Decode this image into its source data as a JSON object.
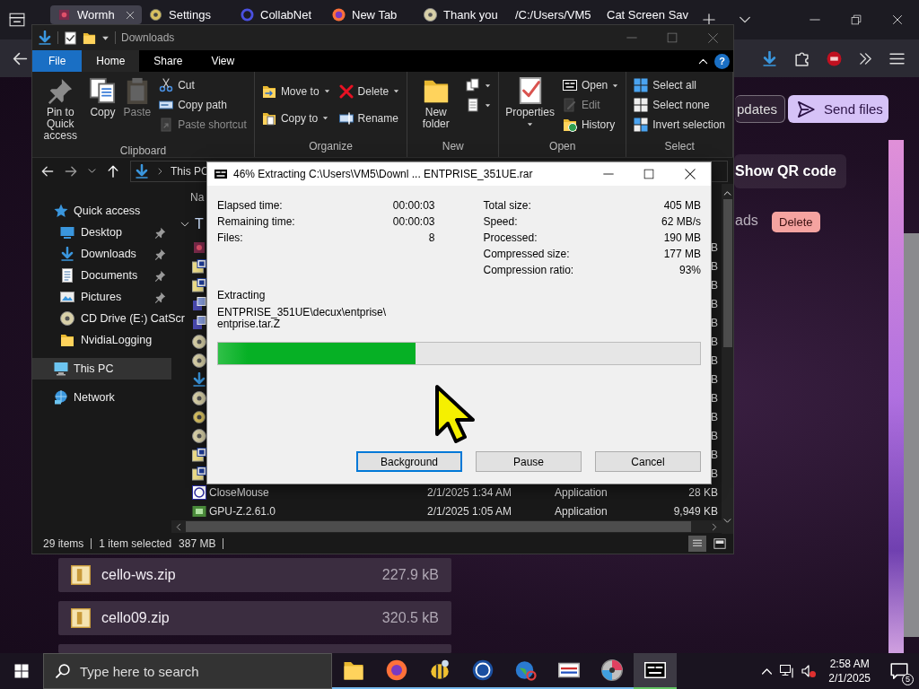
{
  "browser": {
    "tabs": [
      {
        "label": "Wormh",
        "selected": true,
        "kind": "app"
      },
      {
        "label": "Settings",
        "selected": false,
        "kind": "gear"
      },
      {
        "label": "CollabNet",
        "selected": false,
        "kind": "ring"
      },
      {
        "label": "New Tab",
        "selected": false,
        "kind": "browser"
      },
      {
        "label": "Thank you",
        "selected": false,
        "kind": "disc"
      },
      {
        "label": "/C:/Users/VM5",
        "selected": false,
        "kind": "plain"
      },
      {
        "label": "Cat Screen Sav",
        "selected": false,
        "kind": "plain"
      }
    ],
    "page": {
      "header_buttons": [
        {
          "label": "pdates",
          "kind": "outline"
        },
        {
          "label": "Send files",
          "kind": "primary"
        }
      ],
      "qr_button": "Show QR code",
      "section_label": "ads",
      "delete_button": "Delete",
      "files": [
        {
          "name": "cello-ws.zip",
          "size": "227.9 kB"
        },
        {
          "name": "cello09.zip",
          "size": "320.5 kB"
        }
      ]
    }
  },
  "explorer": {
    "title": "Downloads",
    "help_button": "?",
    "ribbon_tabs": [
      {
        "label": "File",
        "kind": "backstage",
        "selected": false
      },
      {
        "label": "Home",
        "kind": "tab",
        "selected": true
      },
      {
        "label": "Share",
        "kind": "tab",
        "selected": false
      },
      {
        "label": "View",
        "kind": "tab",
        "selected": false
      }
    ],
    "ribbon_groups": [
      {
        "label": "Clipboard",
        "columns": [
          {
            "kind": "large",
            "commands": [
              {
                "label": "Pin to Quick access",
                "kind": "pin",
                "disabled": false,
                "dropdown": false
              }
            ]
          },
          {
            "kind": "large",
            "commands": [
              {
                "label": "Copy",
                "kind": "copy",
                "disabled": false,
                "dropdown": false
              }
            ]
          },
          {
            "kind": "large",
            "commands": [
              {
                "label": "Paste",
                "kind": "paste",
                "disabled": true,
                "dropdown": false
              }
            ]
          },
          {
            "kind": "small",
            "commands": [
              {
                "label": "Cut",
                "kind": "cut",
                "disabled": false,
                "dropdown": false
              },
              {
                "label": "Copy path",
                "kind": "path",
                "disabled": false,
                "dropdown": false
              },
              {
                "label": "Paste shortcut",
                "kind": "shortcut",
                "disabled": true,
                "dropdown": false
              }
            ]
          }
        ]
      },
      {
        "label": "Organize",
        "columns": [
          {
            "kind": "small",
            "commands": [
              {
                "label": "Move to",
                "kind": "moveto",
                "disabled": false,
                "dropdown": true
              },
              {
                "label": "Copy to",
                "kind": "copyto",
                "disabled": false,
                "dropdown": true
              }
            ]
          },
          {
            "kind": "small",
            "commands": [
              {
                "label": "Delete",
                "kind": "del",
                "disabled": false,
                "dropdown": true
              },
              {
                "label": "Rename",
                "kind": "rename",
                "disabled": false,
                "dropdown": false
              }
            ]
          }
        ]
      },
      {
        "label": "New",
        "columns": [
          {
            "kind": "large",
            "commands": [
              {
                "label": "New folder",
                "kind": "folder",
                "disabled": false,
                "dropdown": false
              }
            ]
          },
          {
            "kind": "small",
            "commands": [
              {
                "kind": "newitem",
                "disabled": false,
                "dropdown": true
              },
              {
                "kind": "easy",
                "disabled": false,
                "dropdown": true
              }
            ]
          }
        ]
      },
      {
        "label": "Open",
        "columns": [
          {
            "kind": "large",
            "commands": [
              {
                "label": "Properties",
                "kind": "props",
                "disabled": false,
                "dropdown": true
              }
            ]
          },
          {
            "kind": "small",
            "commands": [
              {
                "label": "Open",
                "kind": "sevenz",
                "disabled": false,
                "dropdown": true
              },
              {
                "label": "Edit",
                "kind": "edit",
                "disabled": true,
                "dropdown": false
              },
              {
                "label": "History",
                "kind": "history",
                "disabled": false,
                "dropdown": false
              }
            ]
          }
        ]
      },
      {
        "label": "Select",
        "columns": [
          {
            "kind": "small",
            "commands": [
              {
                "label": "Select all",
                "kind": "gridall",
                "disabled": false,
                "dropdown": false
              },
              {
                "label": "Select none",
                "kind": "gridnone",
                "disabled": false,
                "dropdown": false
              },
              {
                "label": "Invert selection",
                "kind": "gridinv",
                "disabled": false,
                "dropdown": false
              }
            ]
          }
        ]
      }
    ],
    "address": "This PC",
    "nav": [
      {
        "label": "Quick access",
        "kind": "star",
        "selected": false,
        "children": [
          {
            "label": "Desktop",
            "kind": "desktop",
            "pinned": true,
            "selected": false
          },
          {
            "label": "Downloads",
            "kind": "download",
            "pinned": true,
            "selected": false
          },
          {
            "label": "Documents",
            "kind": "document",
            "pinned": true,
            "selected": false
          },
          {
            "label": "Pictures",
            "kind": "picture",
            "pinned": true,
            "selected": false
          },
          {
            "label": "CD Drive (E:) CatScr",
            "kind": "disc",
            "pinned": false,
            "selected": false
          },
          {
            "label": "NvidiaLogging",
            "kind": "folder",
            "pinned": false,
            "selected": false
          }
        ]
      },
      {
        "label": "This PC",
        "kind": "computer",
        "selected": true
      },
      {
        "label": "Network",
        "kind": "network",
        "selected": false
      }
    ],
    "file_list": {
      "column": "Na",
      "group": "T",
      "rows": [
        {
          "kind": "app",
          "size": "B"
        },
        {
          "kind": "archive",
          "size": "B"
        },
        {
          "kind": "archive",
          "size": "B"
        },
        {
          "kind": "setup",
          "size": "B"
        },
        {
          "kind": "setup",
          "size": "B"
        },
        {
          "kind": "disc",
          "size": "B"
        },
        {
          "kind": "disc",
          "size": "B"
        },
        {
          "kind": "download",
          "size": "B"
        },
        {
          "kind": "disc",
          "size": "B"
        },
        {
          "kind": "gear",
          "size": "B"
        },
        {
          "kind": "disc",
          "size": "B"
        },
        {
          "kind": "archive",
          "size": "B"
        },
        {
          "kind": "archive",
          "size": "B"
        },
        {
          "kind": "appblue",
          "name": "CloseMouse",
          "date": "2/1/2025 1:34 AM",
          "type": "Application",
          "size": "28 KB"
        },
        {
          "kind": "chip",
          "name": "GPU-Z.2.61.0",
          "date": "2/1/2025 1:05 AM",
          "type": "Application",
          "size": "9,949 KB"
        }
      ]
    },
    "status": {
      "count": "29 items",
      "selection": "1 item selected",
      "selection_size": "387 MB"
    }
  },
  "extract_dialog": {
    "title": "46% Extracting C:\\Users\\VM5\\Downl ... ENTPRISE_351UE.rar",
    "left_stats": [
      {
        "label": "Elapsed time:",
        "value": "00:00:03"
      },
      {
        "label": "Remaining time:",
        "value": "00:00:03"
      },
      {
        "label": "Files:",
        "value": "8"
      }
    ],
    "right_stats": [
      {
        "label": "Total size:",
        "value": "405 MB"
      },
      {
        "label": "Speed:",
        "value": "62 MB/s"
      },
      {
        "label": "Processed:",
        "value": "190 MB"
      },
      {
        "label": "Compressed size:",
        "value": "177 MB"
      },
      {
        "label": "Compression ratio:",
        "value": "93%"
      }
    ],
    "status_label": "Extracting",
    "current_file": "ENTPRISE_351UE\\decux\\entprise\\\nentprise.tar.Z",
    "progress": {
      "level": 0.41
    },
    "buttons": [
      {
        "label": "Background",
        "focused": true
      },
      {
        "label": "Pause",
        "focused": false
      },
      {
        "label": "Cancel",
        "focused": false
      }
    ]
  },
  "taskbar": {
    "search_placeholder": "Type here to search",
    "apps": [
      {
        "kind": "folder",
        "active": false
      },
      {
        "kind": "browser",
        "active": false
      },
      {
        "kind": "bee",
        "active": false
      },
      {
        "kind": "csi",
        "active": false
      },
      {
        "kind": "globe",
        "active": false
      },
      {
        "kind": "card",
        "active": false
      },
      {
        "kind": "dvd",
        "active": false
      },
      {
        "kind": "sevenz",
        "active": true
      }
    ],
    "time": "2:58 AM",
    "date": "2/1/2025",
    "notifications": "5"
  }
}
